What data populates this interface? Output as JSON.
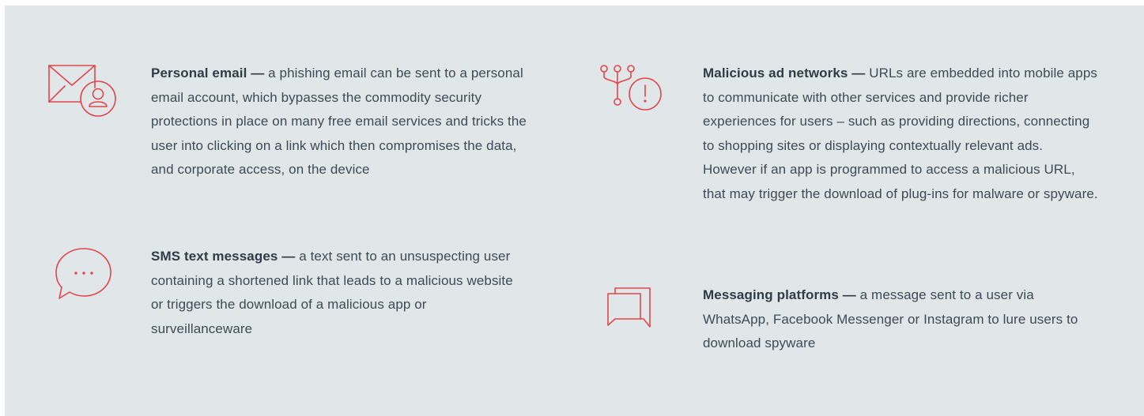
{
  "colors": {
    "background": "#e1e7e9",
    "accent": "#e2454b",
    "text": "#3d4a55"
  },
  "items": [
    {
      "icon": "envelope-user-icon",
      "title": "Personal email —",
      "body": " a phishing email can be sent to a personal email account, which bypasses the commodity security protections in place on many free email services and tricks the user into clicking on a link which then compromises the data, and corporate access, on the device"
    },
    {
      "icon": "chat-bubble-ellipsis-icon",
      "title": "SMS text messages —",
      "body": " a text sent to an unsuspecting user containing a shortened link that leads to a malicious website or triggers the download of a malicious app or surveillanceware"
    },
    {
      "icon": "network-alert-icon",
      "title": "Malicious ad networks —",
      "body": " URLs are embedded into mobile apps to communicate with other services and provide richer experiences for users – such as providing directions, connecting to shopping sites or displaying contextually relevant ads. However if an app is programmed to access a malicious URL, that may trigger the download of plug-ins for malware or spyware."
    },
    {
      "icon": "messaging-bubbles-icon",
      "title": "Messaging platforms —",
      "body": " a message sent to a user via WhatsApp, Facebook Messenger or Instagram to lure users to download spyware"
    }
  ]
}
